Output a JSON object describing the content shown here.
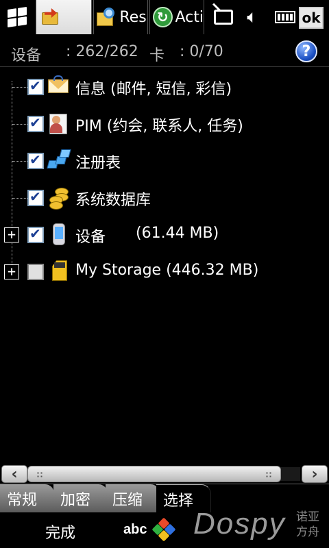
{
  "taskbar": {
    "tabs": [
      {
        "label": "",
        "icon": "folder-arrow-icon"
      },
      {
        "label": "Res",
        "icon": "folder-magnifier-icon"
      },
      {
        "label": "Acti",
        "icon": "sync-icon"
      }
    ],
    "ok_label": "ok"
  },
  "status": {
    "device_label": "设备",
    "device_value": ": 262/262",
    "card_label": "卡",
    "card_value": ": 0/70",
    "help_label": "?"
  },
  "tree": {
    "items": [
      {
        "label": "信息 (邮件, 短信, 彩信)",
        "checked": true,
        "icon": "mail-icon",
        "expandable": false
      },
      {
        "label": "PIM (约会, 联系人, 任务)",
        "checked": true,
        "icon": "contact-card-icon",
        "expandable": false
      },
      {
        "label": "注册表",
        "checked": true,
        "icon": "registry-icon",
        "expandable": false
      },
      {
        "label": "系统数据库",
        "checked": true,
        "icon": "database-coins-icon",
        "expandable": false
      },
      {
        "label": "设备",
        "size": "(61.44 MB)",
        "checked": true,
        "icon": "device-icon",
        "expandable": true
      },
      {
        "label": "My Storage (446.32 MB)",
        "checked": false,
        "icon": "sd-card-icon",
        "expandable": true
      }
    ]
  },
  "scrollbar": {
    "left_arrow": "‹",
    "right_arrow": "›"
  },
  "tabs": [
    {
      "label": "常规",
      "active": false
    },
    {
      "label": "加密",
      "active": false
    },
    {
      "label": "压缩",
      "active": false
    },
    {
      "label": "选择",
      "active": true
    }
  ],
  "menubar": {
    "left_softkey": "完成",
    "input_mode": "abc",
    "watermark": "Dospy",
    "watermark_cn_1": "诺亚",
    "watermark_cn_2": "方舟"
  },
  "colors": {
    "background": "#000000",
    "checkbox_border": "#7f9db9",
    "check_mark": "#1c3f94",
    "help_icon": "#1b4fc2"
  }
}
